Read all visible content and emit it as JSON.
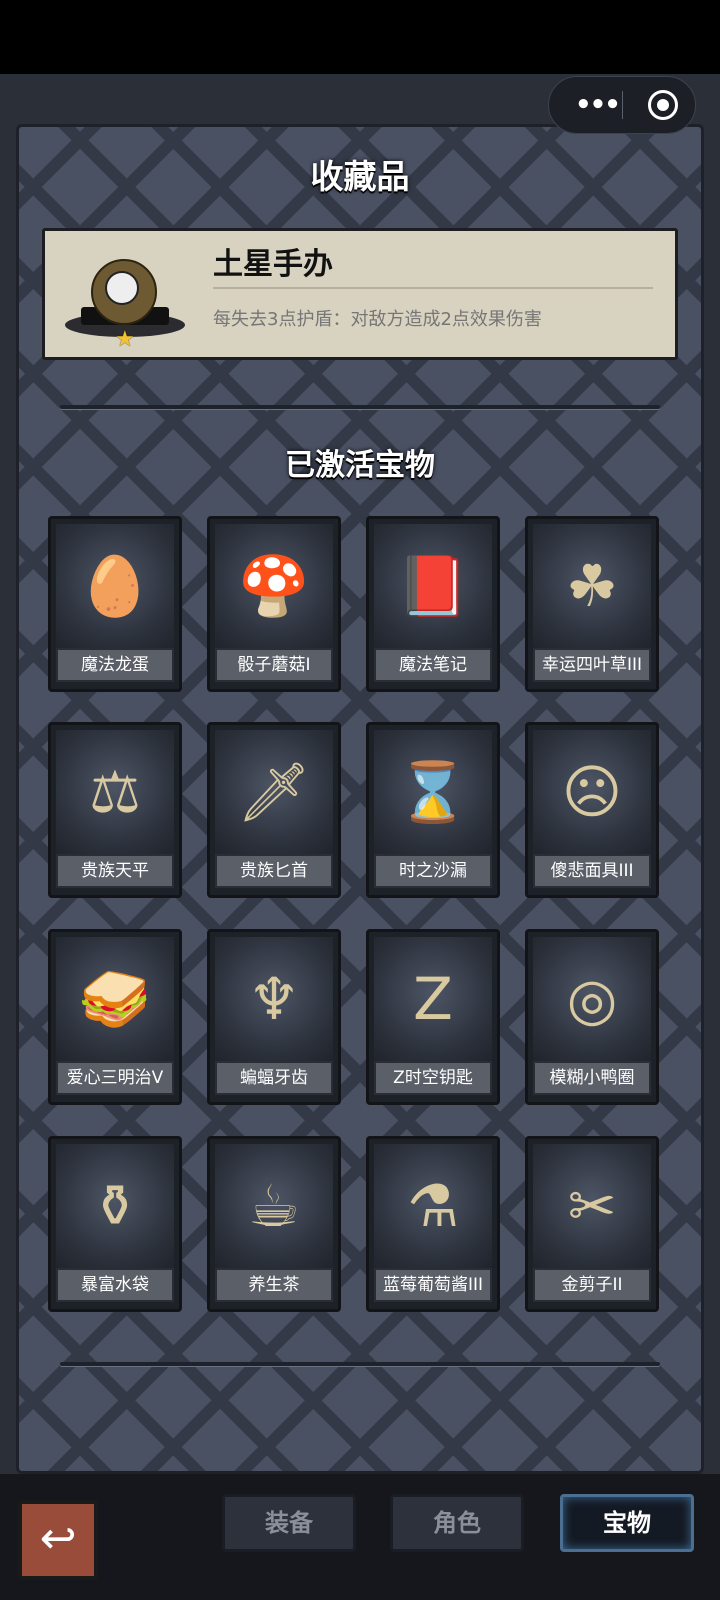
{
  "header": {
    "title": "收藏品",
    "more_icon": "ellipsis-icon",
    "target_icon": "target-icon"
  },
  "featured": {
    "name": "土星手办",
    "description": "每失去3点护盾：对敌方造成2点效果伤害",
    "rarity_icon": "star-icon",
    "star_color": "#f1c232"
  },
  "section": {
    "title": "已激活宝物"
  },
  "treasures": [
    {
      "label": "魔法龙蛋",
      "icon": "dragon-egg-icon"
    },
    {
      "label": "骰子蘑菇I",
      "icon": "mushroom-icon"
    },
    {
      "label": "魔法笔记",
      "icon": "spellbook-icon"
    },
    {
      "label": "幸运四叶草III",
      "icon": "clover-icon"
    },
    {
      "label": "贵族天平",
      "icon": "scales-icon"
    },
    {
      "label": "贵族匕首",
      "icon": "dagger-icon"
    },
    {
      "label": "时之沙漏",
      "icon": "hourglass-icon"
    },
    {
      "label": "傻悲面具III",
      "icon": "mask-icon"
    },
    {
      "label": "爱心三明治V",
      "icon": "sandwich-icon"
    },
    {
      "label": "蝙蝠牙齿",
      "icon": "bat-teeth-icon"
    },
    {
      "label": "Z时空钥匙",
      "icon": "z-orb-icon"
    },
    {
      "label": "模糊小鸭圈",
      "icon": "duck-ring-icon"
    },
    {
      "label": "暴富水袋",
      "icon": "water-bag-icon"
    },
    {
      "label": "养生茶",
      "icon": "tea-cup-icon"
    },
    {
      "label": "蓝莓葡萄酱III",
      "icon": "jam-jar-icon"
    },
    {
      "label": "金剪子II",
      "icon": "scissors-icon"
    }
  ],
  "bottom_nav": {
    "back_icon": "back-arrow-icon",
    "tabs": [
      {
        "label": "装备"
      },
      {
        "label": "角色"
      },
      {
        "label": "宝物",
        "active": true
      }
    ]
  },
  "colors": {
    "panel": "#4a5163",
    "card": "#d8d2c0",
    "active_tab_glow": "#4a6f92"
  }
}
